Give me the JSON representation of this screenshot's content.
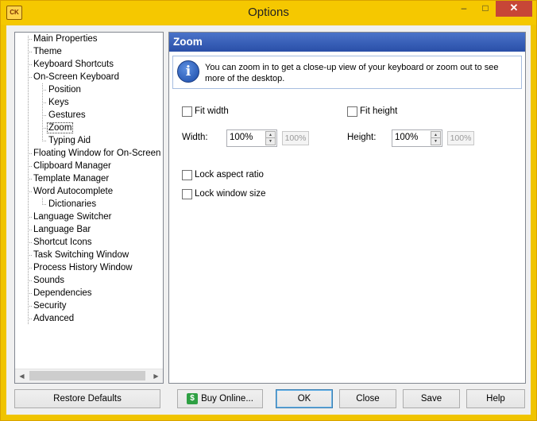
{
  "window": {
    "title": "Options",
    "app_icon_text": "CK"
  },
  "titlebar_buttons": {
    "minimize": "–",
    "maximize": "□",
    "close": "✕"
  },
  "tree": {
    "items": [
      {
        "label": "Main Properties"
      },
      {
        "label": "Theme"
      },
      {
        "label": "Keyboard Shortcuts"
      },
      {
        "label": "On-Screen Keyboard"
      },
      {
        "label": "Position"
      },
      {
        "label": "Keys"
      },
      {
        "label": "Gestures"
      },
      {
        "label": "Zoom",
        "selected": true
      },
      {
        "label": "Typing Aid"
      },
      {
        "label": "Floating Window for On-Screen Ke"
      },
      {
        "label": "Clipboard Manager"
      },
      {
        "label": "Template Manager"
      },
      {
        "label": "Word Autocomplete"
      },
      {
        "label": "Dictionaries"
      },
      {
        "label": "Language Switcher"
      },
      {
        "label": "Language Bar"
      },
      {
        "label": "Shortcut Icons"
      },
      {
        "label": "Task Switching Window"
      },
      {
        "label": "Process History Window"
      },
      {
        "label": "Sounds"
      },
      {
        "label": "Dependencies"
      },
      {
        "label": "Security"
      },
      {
        "label": "Advanced"
      }
    ]
  },
  "panel": {
    "title": "Zoom",
    "info_text": "You can zoom in to get a close-up view of your keyboard or zoom out to see more of the desktop.",
    "fit_width_label": "Fit width",
    "fit_height_label": "Fit height",
    "width_label": "Width:",
    "height_label": "Height:",
    "width_value": "100%",
    "height_value": "100%",
    "width_readonly": "100%",
    "height_readonly": "100%",
    "lock_aspect_label": "Lock aspect ratio",
    "lock_window_label": "Lock window size",
    "fit_width_checked": false,
    "fit_height_checked": false,
    "lock_aspect_checked": false,
    "lock_window_checked": false
  },
  "buttons": {
    "restore": "Restore Defaults",
    "buy": "Buy Online...",
    "ok": "OK",
    "close": "Close",
    "save": "Save",
    "help": "Help"
  }
}
